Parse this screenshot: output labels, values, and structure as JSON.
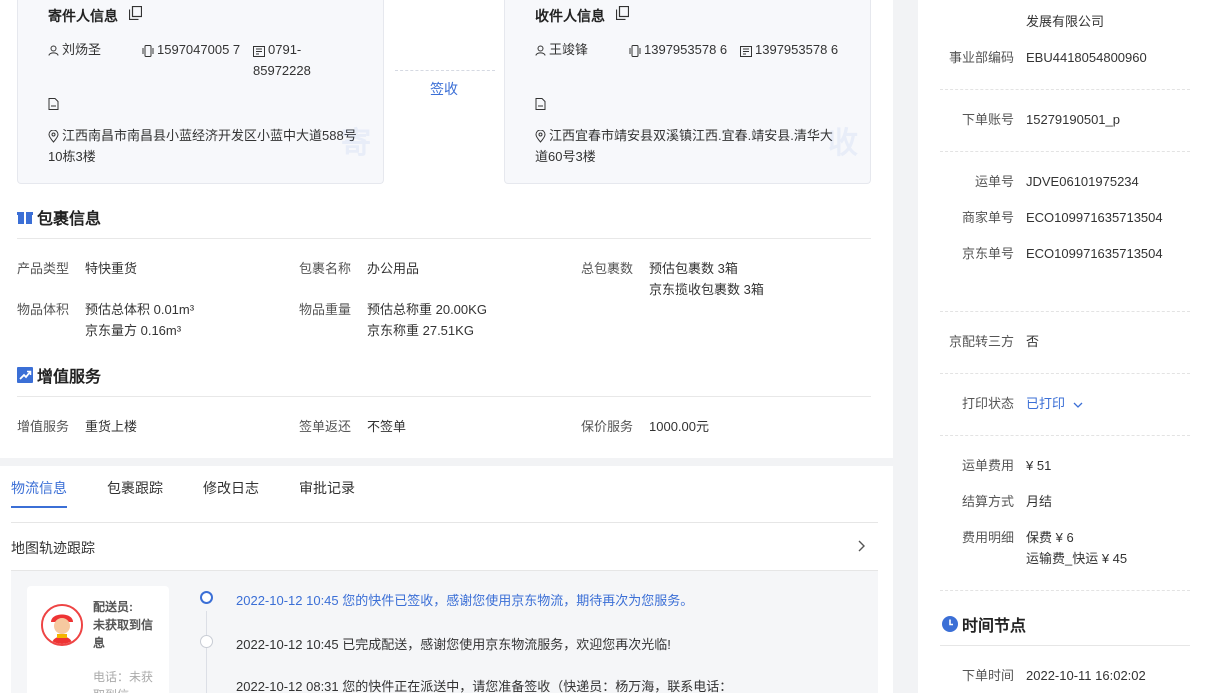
{
  "sender": {
    "title": "寄件人信息",
    "name": "刘炀圣",
    "mobile": "1597047005 7",
    "phone": "0791- 85972228",
    "address": "江西南昌市南昌县小蓝经济开发区小蓝中大道588号10栋3楼",
    "watermark": "寄"
  },
  "receiver": {
    "title": "收件人信息",
    "name": "王竣锋",
    "mobile": "1397953578 6",
    "phone": "1397953578 6",
    "address": "江西宜春市靖安县双溪镇江西.宜春.靖安县.清华大道60号3楼",
    "watermark": "收"
  },
  "sign_link": "签收",
  "package": {
    "title": "包裹信息",
    "product_type_label": "产品类型",
    "product_type": "特快重货",
    "package_name_label": "包裹名称",
    "package_name": "办公用品",
    "total_label": "总包裹数",
    "total_estimated": "预估包裹数 3箱",
    "total_collected": "京东揽收包裹数 3箱",
    "volume_label": "物品体积",
    "volume_estimated": "预估总体积 0.01m³",
    "volume_jd": "京东量方 0.16m³",
    "weight_label": "物品重量",
    "weight_estimated": "预估总称重 20.00KG",
    "weight_jd": "京东称重 27.51KG"
  },
  "value_added": {
    "title": "增值服务",
    "service_label": "增值服务",
    "service": "重货上楼",
    "receipt_label": "签单返还",
    "receipt": "不签单",
    "insurance_label": "保价服务",
    "insurance": "1000.00元"
  },
  "tabs": [
    "物流信息",
    "包裹跟踪",
    "修改日志",
    "审批记录"
  ],
  "map_tracking": "地图轨迹跟踪",
  "courier": {
    "label": "配送员:",
    "name": "未获取到信息",
    "phone": "电话：未获取到信"
  },
  "timeline": [
    "2022-10-12 10:45 您的快件已签收，感谢您使用京东物流，期待再次为您服务。",
    "2022-10-12 10:45 已完成配送，感谢您使用京东物流服务，欢迎您再次光临!",
    "2022-10-12 08:31 您的快件正在派送中，请您准备签收（快递员：杨万海，联系电话："
  ],
  "right": {
    "company_partial": "发展有限公司",
    "bu_code_label": "事业部编码",
    "bu_code": "EBU4418054800960",
    "account_label": "下单账号",
    "account": "15279190501_p",
    "waybill_label": "运单号",
    "waybill": "JDVE06101975234",
    "merchant_no_label": "商家单号",
    "merchant_no": "ECO109971635713504",
    "jd_no_label": "京东单号",
    "jd_no": "ECO109971635713504",
    "third_party_label": "京配转三方",
    "third_party": "否",
    "print_label": "打印状态",
    "print_status": "已打印",
    "fee_label": "运单费用",
    "fee": "¥ 51",
    "settle_label": "结算方式",
    "settle": "月结",
    "fee_detail_label": "费用明细",
    "fee_detail_1": "保费 ¥ 6",
    "fee_detail_2": "运输费_快运 ¥ 45",
    "time_title": "时间节点",
    "order_time_label": "下单时间",
    "order_time": "2022-10-11 16:02:02"
  },
  "colors": {
    "accent": "#3b6fd6",
    "avatar_ring": "#e44444"
  }
}
